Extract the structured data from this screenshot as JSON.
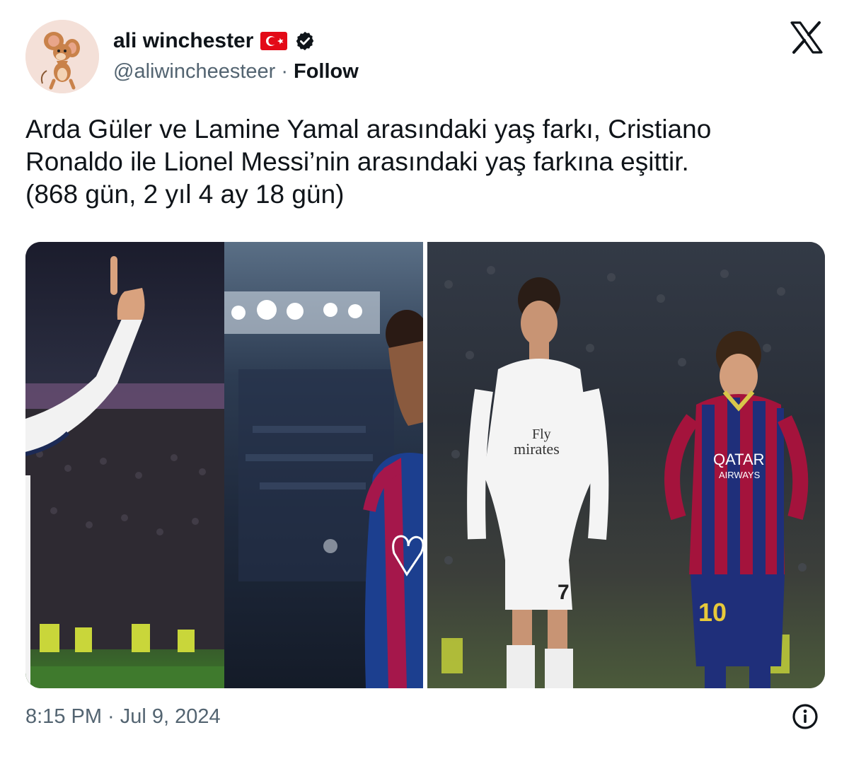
{
  "author": {
    "name": "ali winchester",
    "handle": "@aliwincheesteer",
    "separator": "·",
    "follow_label": "Follow",
    "avatar_icon": "cartoon-mouse-avatar",
    "flag_icon": "turkey-flag-icon",
    "verified_icon": "verified-badge-icon"
  },
  "platform_icon": "x-logo-icon",
  "tweet": {
    "lines": [
      "Arda Güler ve Lamine Yamal arasındaki yaş farkı, Cristiano",
      "Ronaldo ile Lionel Messi’nin arasındaki yaş farkına eşittir.",
      "(868 gün, 2 yıl 4 ay 18 gün)"
    ]
  },
  "media": {
    "left_panel_kit_text": "Fly\nmirates",
    "messi_kit_text": "QATAR\nAIRWAYS",
    "ronaldo_number": "7",
    "messi_number": "10"
  },
  "footer": {
    "timestamp": "8:15 PM · Jul 9, 2024",
    "info_icon": "info-icon"
  },
  "colors": {
    "text_primary": "#0f1419",
    "text_secondary": "#536471",
    "turkey_red": "#e30a17"
  }
}
